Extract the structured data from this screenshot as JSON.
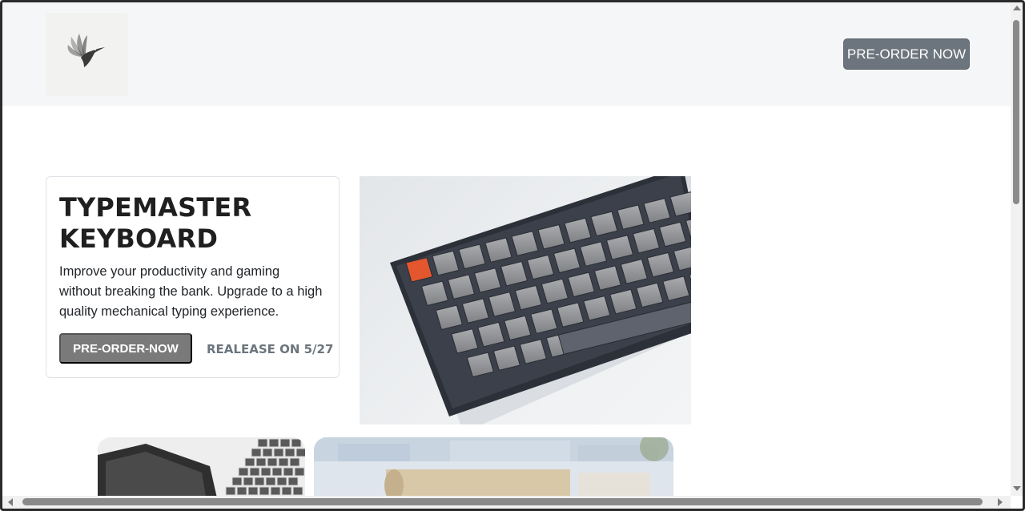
{
  "header": {
    "logo_icon": "hummingbird-logo-icon",
    "cta_label": "PRE-ORDER NOW"
  },
  "hero": {
    "title_line1": "TYPEMASTER",
    "title_line2": "KEYBOARD",
    "description": "Improve your productivity and gaming without breaking the bank. Upgrade to a high quality mechanical typing experience.",
    "cta_label": "PRE-ORDER-NOW",
    "release_text": "REALEASE ON 5/27"
  },
  "colors": {
    "header_bg": "#f5f6f7",
    "header_button": "#6c757d",
    "hero_button": "#7a7a7a",
    "release_text": "#6c757d",
    "accent_key": "#e4572e"
  }
}
